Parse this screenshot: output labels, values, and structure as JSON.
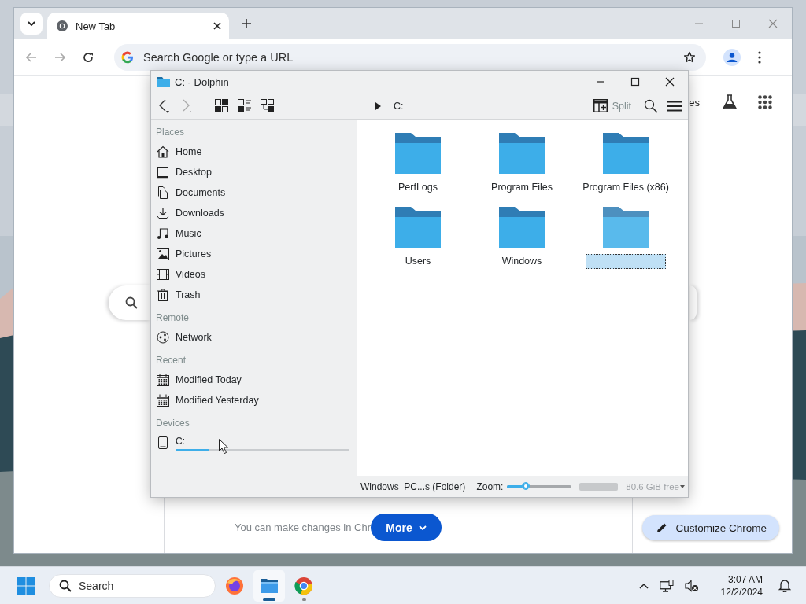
{
  "browser": {
    "tabs": [
      {
        "title": "New Tab",
        "selected": true
      }
    ],
    "address_placeholder": "Search Google or type a URL",
    "header_link": "es",
    "bottom_text": "You can make changes in Chr",
    "more_button": "More",
    "customize_button": "Customize Chrome"
  },
  "file_manager": {
    "title": "C: - Dolphin",
    "breadcrumb": "C:",
    "split_button": "Split",
    "sidebar": [
      {
        "heading": "Places",
        "items": [
          {
            "label": "Home"
          },
          {
            "label": "Desktop"
          },
          {
            "label": "Documents"
          },
          {
            "label": "Downloads"
          },
          {
            "label": "Music"
          },
          {
            "label": "Pictures"
          },
          {
            "label": "Videos"
          },
          {
            "label": "Trash"
          }
        ]
      },
      {
        "heading": "Remote",
        "items": [
          {
            "label": "Network"
          }
        ]
      },
      {
        "heading": "Recent",
        "items": [
          {
            "label": "Modified Today"
          },
          {
            "label": "Modified Yesterday"
          }
        ]
      },
      {
        "heading": "Devices",
        "items": [
          {
            "label": "C:",
            "level": 0.19
          }
        ]
      }
    ],
    "files": [
      {
        "name": "PerfLogs",
        "selected": false
      },
      {
        "name": "Program Files",
        "selected": false
      },
      {
        "name": "Program Files (x86)",
        "selected": false
      },
      {
        "name": "Users",
        "selected": false
      },
      {
        "name": "Windows",
        "selected": false
      },
      {
        "selected": true,
        "renaming": true
      }
    ],
    "status": {
      "selection": "Windows_PC...s (Folder)",
      "zoom_label": "Zoom:",
      "zoom_level": {
        "level": 0.3
      },
      "free_space": "80.6 GiB free"
    }
  },
  "taskbar": {
    "search_placeholder": "Search",
    "apps": [
      {
        "kind": "firefox",
        "running": false,
        "active": false
      },
      {
        "kind": "files",
        "running": true,
        "active": true
      },
      {
        "kind": "chrome",
        "running": true,
        "active": false
      }
    ],
    "time": "3:07 AM",
    "date": "12/2/2024"
  }
}
